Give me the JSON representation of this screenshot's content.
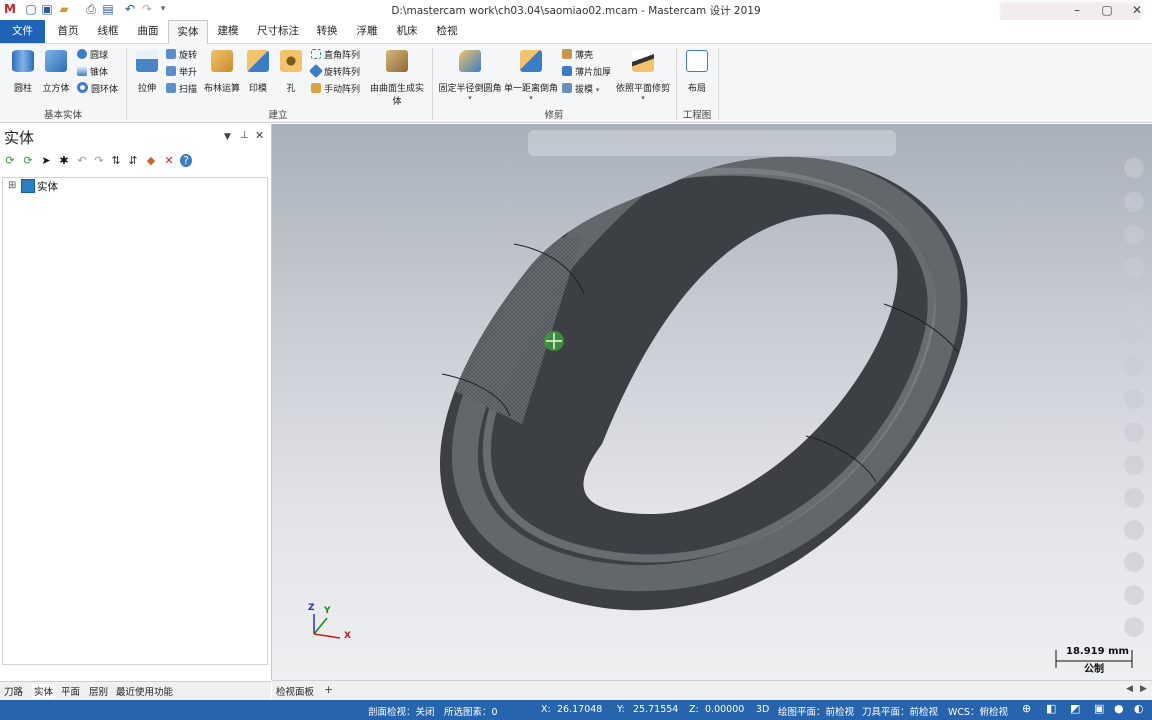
{
  "window": {
    "title": "D:\\mastercam work\\ch03.04\\saomiao02.mcam - Mastercam 设计 2019"
  },
  "tabs": [
    "文件",
    "首页",
    "线框",
    "曲面",
    "实体",
    "建模",
    "尺寸标注",
    "转换",
    "浮雕",
    "机床",
    "检视"
  ],
  "active_tab": "实体",
  "ribbon": {
    "groups": {
      "basic": "基本实体",
      "create": "建立",
      "modify": "修剪",
      "drawing": "工程图"
    },
    "basic": {
      "cylinder": "圆柱",
      "cube": "立方体",
      "sphere": "圆球",
      "cone": "锥体",
      "torus": "圆环体"
    },
    "create": {
      "extrude": "拉伸",
      "revolve": "旋转",
      "loft": "举升",
      "sweep": "扫描",
      "boolean": "布林运算",
      "imprint": "印模",
      "hole": "孔",
      "rect_pattern": "直角阵列",
      "rotary_pattern": "旋转阵列",
      "manual_pattern": "手动阵列",
      "from_surfaces": "由曲面生成实体"
    },
    "modify": {
      "fixed_fillet": "固定半径倒圆角",
      "one_distance_chamfer": "单一距离倒角",
      "shell": "薄壳",
      "thicken": "薄片加厚",
      "draft": "拔模",
      "trim_to_plane": "依照平面修剪"
    },
    "drawing": {
      "layout": "布局"
    }
  },
  "panel": {
    "title": "实体",
    "tree_root": "实体",
    "bottom_tabs": [
      "刀路",
      "实体",
      "平面",
      "层别",
      "最近使用功能"
    ]
  },
  "viewport": {
    "sheet_tab": "检视面板",
    "add_tab": "+",
    "axis": {
      "x": "X",
      "y": "Y",
      "z": "Z"
    },
    "scale_value": "18.919 mm",
    "scale_unit": "公制"
  },
  "status": {
    "section_view": "剖面检视：关闭",
    "selected": "所选图素：0",
    "x_label": "X:",
    "x": "26.17048",
    "y_label": "Y:",
    "y": "25.71554",
    "z_label": "Z:",
    "z": "0.00000",
    "mode": "3D",
    "cplane": "绘图平面：前检视",
    "tplane": "刀具平面：前检视",
    "wcs": "WCS：俯检视"
  },
  "colors": {
    "file_tab": "#1e63b6",
    "status_bar": "#2764ae",
    "solid_gray": "#555a5f"
  }
}
